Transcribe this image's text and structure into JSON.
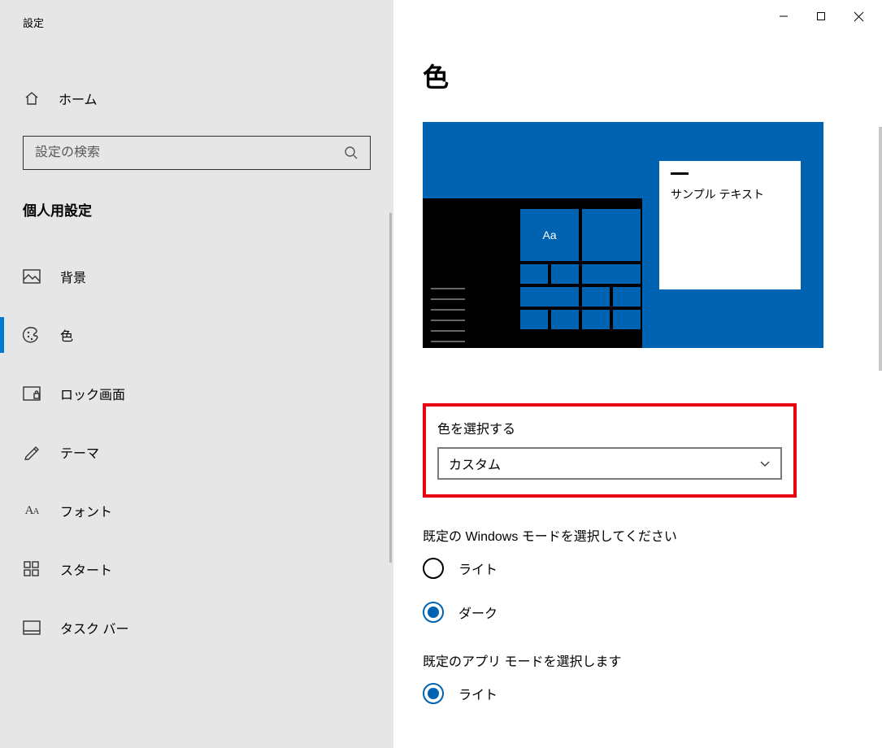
{
  "window": {
    "title": "設定"
  },
  "sidebar": {
    "home": "ホーム",
    "search_placeholder": "設定の検索",
    "section": "個人用設定",
    "items": [
      {
        "label": "背景",
        "icon": "image-icon",
        "active": false
      },
      {
        "label": "色",
        "icon": "palette-icon",
        "active": true
      },
      {
        "label": "ロック画面",
        "icon": "lock-screen-icon",
        "active": false
      },
      {
        "label": "テーマ",
        "icon": "theme-icon",
        "active": false
      },
      {
        "label": "フォント",
        "icon": "font-icon",
        "active": false
      },
      {
        "label": "スタート",
        "icon": "start-icon",
        "active": false
      },
      {
        "label": "タスク バー",
        "icon": "taskbar-icon",
        "active": false
      }
    ]
  },
  "main": {
    "title": "色",
    "preview": {
      "tile_glyph": "Aa",
      "sample_text": "サンプル テキスト"
    },
    "color_select": {
      "label": "色を選択する",
      "value": "カスタム"
    },
    "windows_mode": {
      "label": "既定の Windows モードを選択してください",
      "options": {
        "light": "ライト",
        "dark": "ダーク"
      },
      "selected": "dark"
    },
    "app_mode": {
      "label": "既定のアプリ モードを選択します",
      "options": {
        "light": "ライト"
      },
      "selected": "light"
    }
  },
  "colors": {
    "accent": "#0063b1",
    "highlight_border": "#e60012"
  }
}
